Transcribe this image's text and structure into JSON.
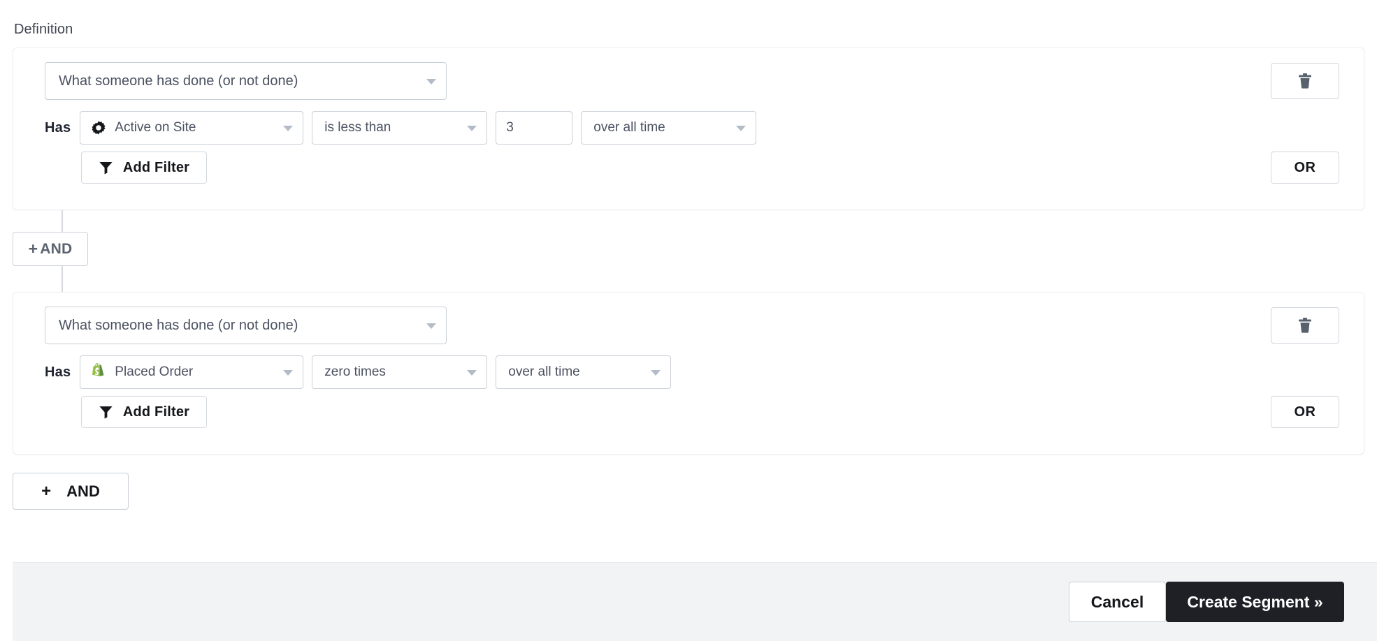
{
  "section": {
    "label": "Definition"
  },
  "conditions": [
    {
      "type_label": "What someone has done (or not done)",
      "has_label": "Has",
      "metric": "Active on Site",
      "metric_icon": "gear-icon",
      "operator": "is less than",
      "value": "3",
      "timeframe": "over all time",
      "add_filter_label": "Add Filter",
      "or_label": "OR",
      "delete_icon": "trash-icon"
    },
    {
      "type_label": "What someone has done (or not done)",
      "has_label": "Has",
      "metric": "Placed Order",
      "metric_icon": "shopify-bag-icon",
      "operator": "zero times",
      "timeframe": "over all time",
      "add_filter_label": "Add Filter",
      "or_label": "OR",
      "delete_icon": "trash-icon"
    }
  ],
  "connectors": {
    "and_pill_plus": "+",
    "and_pill_label": "AND",
    "and_bottom_plus": "+",
    "and_bottom_label": "AND"
  },
  "footer": {
    "cancel_label": "Cancel",
    "create_label": "Create Segment »"
  },
  "colors": {
    "accent_dark": "#1e2025",
    "border": "#c9cfd6",
    "card_border": "#eceef0",
    "footer_bg": "#f2f3f5",
    "shopify_green": "#95bf47",
    "caret_gray": "#b3bcc6"
  }
}
